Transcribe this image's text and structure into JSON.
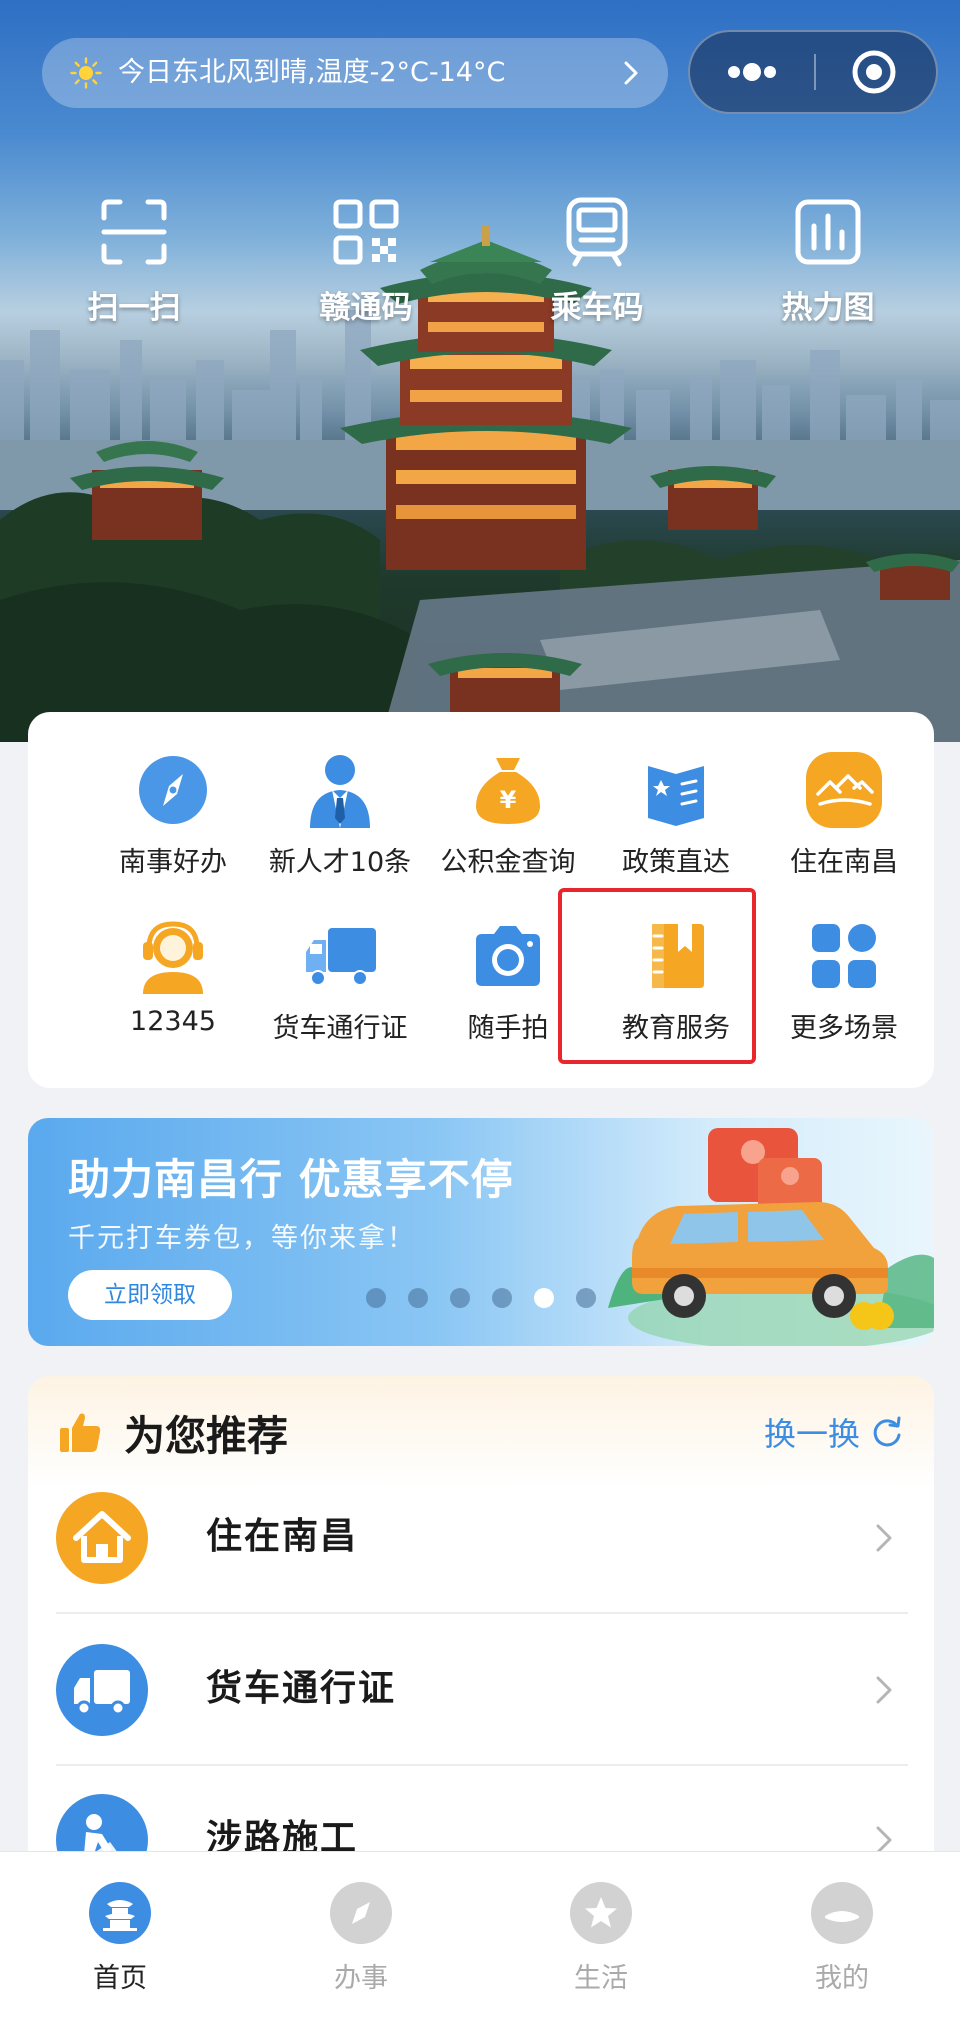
{
  "header": {
    "weather_text": "今日东北风到晴,温度-2°C-14°C"
  },
  "quick_actions": [
    {
      "label": "扫一扫",
      "icon": "scan-icon"
    },
    {
      "label": "赣通码",
      "icon": "qr-code-icon"
    },
    {
      "label": "乘车码",
      "icon": "bus-code-icon"
    },
    {
      "label": "热力图",
      "icon": "heatmap-icon"
    }
  ],
  "services": [
    {
      "label": "南事好办",
      "icon": "compass-icon",
      "color": "#3d8de3"
    },
    {
      "label": "新人才10条",
      "icon": "talent-person-icon",
      "color": "#3d8de3"
    },
    {
      "label": "公积金查询",
      "icon": "money-bag-icon",
      "color": "#f5a623"
    },
    {
      "label": "政策直达",
      "icon": "policy-book-icon",
      "color": "#3d8de3"
    },
    {
      "label": "住在南昌",
      "icon": "housing-icon",
      "color": "#f5a623"
    },
    {
      "label": "12345",
      "icon": "hotline-agent-icon",
      "color": "#f5a623"
    },
    {
      "label": "货车通行证",
      "icon": "truck-icon",
      "color": "#3d8de3"
    },
    {
      "label": "随手拍",
      "icon": "camera-icon",
      "color": "#3d8de3"
    },
    {
      "label": "教育服务",
      "icon": "education-book-icon",
      "color": "#f5a623"
    },
    {
      "label": "更多场景",
      "icon": "grid-more-icon",
      "color": "#3d8de3"
    }
  ],
  "banner": {
    "title": "助力南昌行 优惠享不停",
    "subtitle": "千元打车券包，等你来拿！",
    "button_label": "立即领取",
    "dot_count": 6,
    "active_dot": 5
  },
  "recommend": {
    "title": "为您推荐",
    "refresh_label": "换一换",
    "items": [
      {
        "label": "住在南昌",
        "icon": "house-icon",
        "color": "#f5a623"
      },
      {
        "label": "货车通行证",
        "icon": "truck-icon",
        "color": "#3d8de3"
      },
      {
        "label": "涉路施工",
        "icon": "road-work-icon",
        "color": "#3d8de3"
      }
    ]
  },
  "tabbar": [
    {
      "label": "首页",
      "icon": "home-tower-icon",
      "active": true
    },
    {
      "label": "办事",
      "icon": "compass-icon",
      "active": false
    },
    {
      "label": "生活",
      "icon": "star-icon",
      "active": false
    },
    {
      "label": "我的",
      "icon": "profile-icon",
      "active": false
    }
  ],
  "colors": {
    "accent_blue": "#3d8de3",
    "accent_orange": "#f5a623",
    "highlight_red": "#e8262b"
  }
}
